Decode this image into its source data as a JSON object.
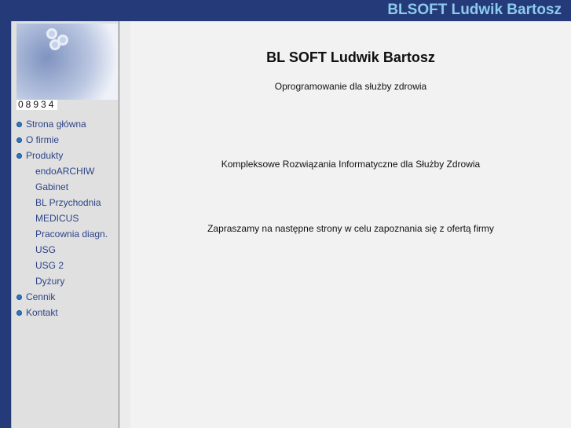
{
  "header": {
    "title": "BLSOFT Ludwik Bartosz"
  },
  "sidebar": {
    "counter": "08934",
    "items": [
      {
        "label": "Strona główna",
        "level": "top"
      },
      {
        "label": "O firmie",
        "level": "top"
      },
      {
        "label": "Produkty",
        "level": "top"
      },
      {
        "label": "endoARCHIW",
        "level": "sub"
      },
      {
        "label": "Gabinet",
        "level": "sub"
      },
      {
        "label": "BL Przychodnia",
        "level": "sub"
      },
      {
        "label": "MEDICUS",
        "level": "sub"
      },
      {
        "label": "Pracownia diagn.",
        "level": "sub"
      },
      {
        "label": "USG",
        "level": "sub"
      },
      {
        "label": "USG 2",
        "level": "sub"
      },
      {
        "label": "Dyżury",
        "level": "sub"
      },
      {
        "label": "Cennik",
        "level": "top"
      },
      {
        "label": "Kontakt",
        "level": "top"
      }
    ]
  },
  "main": {
    "heading": "BL SOFT Ludwik Bartosz",
    "subtitle": "Oprogramowanie dla służby zdrowia",
    "tagline": "Kompleksowe Rozwiązania Informatyczne dla Służby Zdrowia",
    "invite": "Zapraszamy na następne strony w celu zapoznania się z ofertą firmy"
  }
}
